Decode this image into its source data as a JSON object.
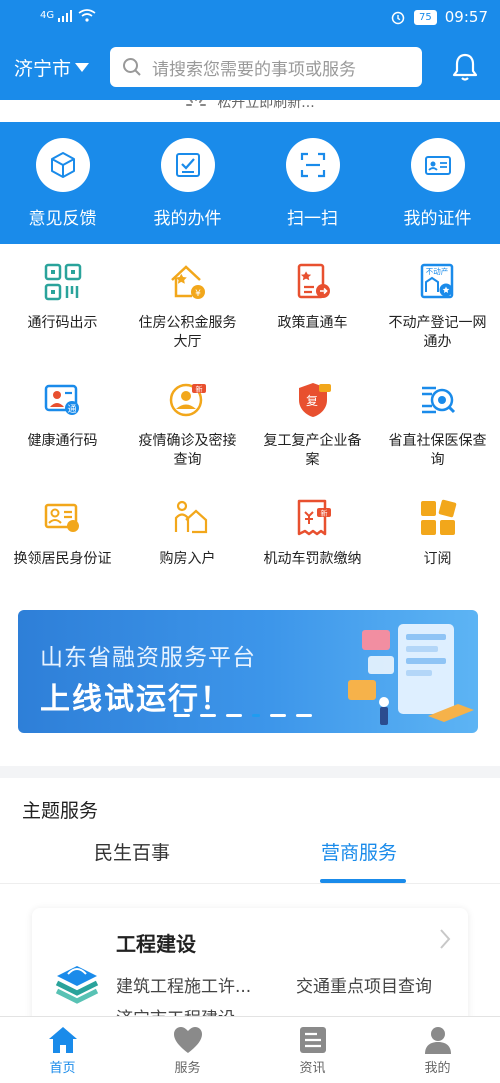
{
  "status": {
    "network": "4G",
    "battery": "75",
    "time": "09:57"
  },
  "header": {
    "city": "济宁市",
    "search_placeholder": "请搜索您需要的事项或服务"
  },
  "refresh_text": "松开立即刷新...",
  "quick_actions": [
    {
      "label": "意见反馈",
      "icon": "cube-icon"
    },
    {
      "label": "我的办件",
      "icon": "checklist-icon"
    },
    {
      "label": "扫一扫",
      "icon": "scan-icon"
    },
    {
      "label": "我的证件",
      "icon": "id-card-icon"
    }
  ],
  "services": [
    {
      "label": "通行码出示",
      "icon": "qr-code-icon"
    },
    {
      "label": "住房公积金服务大厅",
      "icon": "housing-fund-icon"
    },
    {
      "label": "政策直通车",
      "icon": "policy-doc-icon"
    },
    {
      "label": "不动产登记一网通办",
      "icon": "real-estate-icon"
    },
    {
      "label": "健康通行码",
      "icon": "health-code-icon"
    },
    {
      "label": "疫情确诊及密接查询",
      "icon": "epidemic-query-icon"
    },
    {
      "label": "复工复产企业备案",
      "icon": "resume-work-icon"
    },
    {
      "label": "省直社保医保查询",
      "icon": "social-insurance-icon"
    },
    {
      "label": "换领居民身份证",
      "icon": "id-renew-icon"
    },
    {
      "label": "购房入户",
      "icon": "house-purchase-icon"
    },
    {
      "label": "机动车罚款缴纳",
      "icon": "vehicle-fine-icon"
    },
    {
      "label": "订阅",
      "icon": "subscribe-icon"
    }
  ],
  "badges": {
    "new": "新",
    "resume": "复",
    "estate_tag": "不动产",
    "tong": "通"
  },
  "banner": {
    "line1": "山东省融资服务平台",
    "line2": "上线试运行！"
  },
  "theme": {
    "title": "主题服务",
    "tabs": [
      "民生百事",
      "营商服务"
    ],
    "active_tab": 1
  },
  "card": {
    "title": "工程建设",
    "links": [
      "建筑工程施工许...",
      "交通重点项目查询",
      "济宁市工程建设..."
    ]
  },
  "nav": [
    {
      "label": "首页",
      "icon": "home-icon",
      "active": true
    },
    {
      "label": "服务",
      "icon": "heart-icon",
      "active": false
    },
    {
      "label": "资讯",
      "icon": "news-icon",
      "active": false
    },
    {
      "label": "我的",
      "icon": "person-icon",
      "active": false
    }
  ],
  "colors": {
    "brand": "#1a8bea",
    "icon_teal": "#2aa39b",
    "icon_orange": "#f2a71b",
    "icon_red": "#e8502f"
  }
}
